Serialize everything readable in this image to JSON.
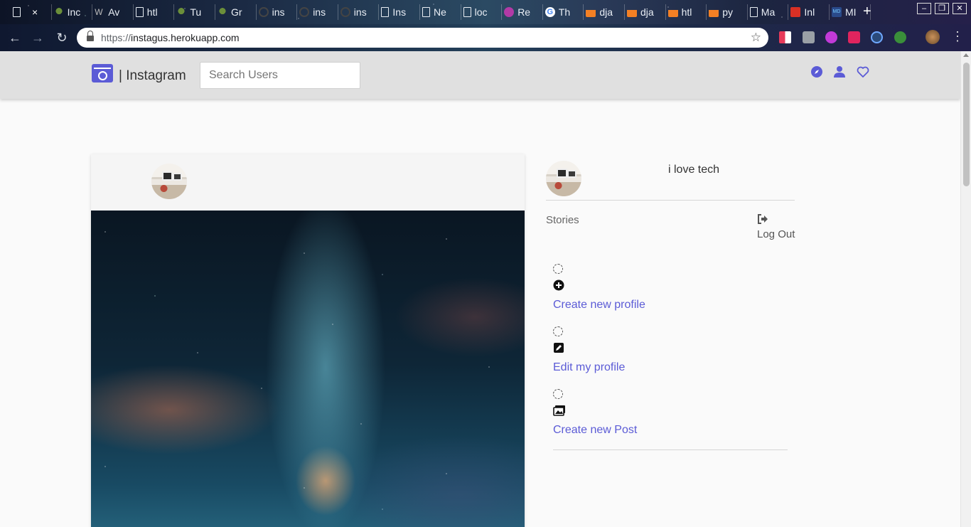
{
  "browser": {
    "tabs": [
      {
        "label": "",
        "favicon": "doc-icon",
        "active": true
      },
      {
        "label": "Inc",
        "favicon": "palm-icon"
      },
      {
        "label": "Av",
        "favicon": "w-icon"
      },
      {
        "label": "htl",
        "favicon": "doc-icon"
      },
      {
        "label": "Tu",
        "favicon": "palm-icon"
      },
      {
        "label": "Gr",
        "favicon": "palm-icon"
      },
      {
        "label": "ins",
        "favicon": "github-icon"
      },
      {
        "label": "ins",
        "favicon": "github-icon"
      },
      {
        "label": "ins",
        "favicon": "github-icon"
      },
      {
        "label": "Ins",
        "favicon": "doc-icon"
      },
      {
        "label": "Ne",
        "favicon": "doc-icon"
      },
      {
        "label": "loc",
        "favicon": "doc-icon"
      },
      {
        "label": "Re",
        "favicon": "magenta-icon"
      },
      {
        "label": "Th",
        "favicon": "google-icon"
      },
      {
        "label": "dja",
        "favicon": "stackoverflow-icon"
      },
      {
        "label": "dja",
        "favicon": "stackoverflow-icon"
      },
      {
        "label": "htl",
        "favicon": "stackoverflow-icon"
      },
      {
        "label": "py",
        "favicon": "stackoverflow-icon"
      },
      {
        "label": "Ma",
        "favicon": "doc-icon"
      },
      {
        "label": "Inl",
        "favicon": "gmail-icon"
      },
      {
        "label": "MI",
        "favicon": "md-icon"
      }
    ],
    "close_glyph": "×",
    "new_tab_glyph": "+",
    "url_scheme": "https://",
    "url_host": "instagus.herokuapp.com"
  },
  "site": {
    "brand": "| Instagram",
    "search_placeholder": "Search Users",
    "nav_icons": [
      "compass-icon",
      "user-icon",
      "heart-icon"
    ],
    "accent": "#5b5bd6",
    "navbar_bg": "#e0e0e0"
  },
  "sidebar": {
    "bio": "i love tech",
    "stories_label": "Stories",
    "logout_label": "Log Out",
    "actions": [
      {
        "icon": "plus-circle-icon",
        "label": "Create new profile"
      },
      {
        "icon": "edit-icon",
        "label": "Edit my profile"
      },
      {
        "icon": "images-icon",
        "label": "Create new Post"
      }
    ]
  }
}
